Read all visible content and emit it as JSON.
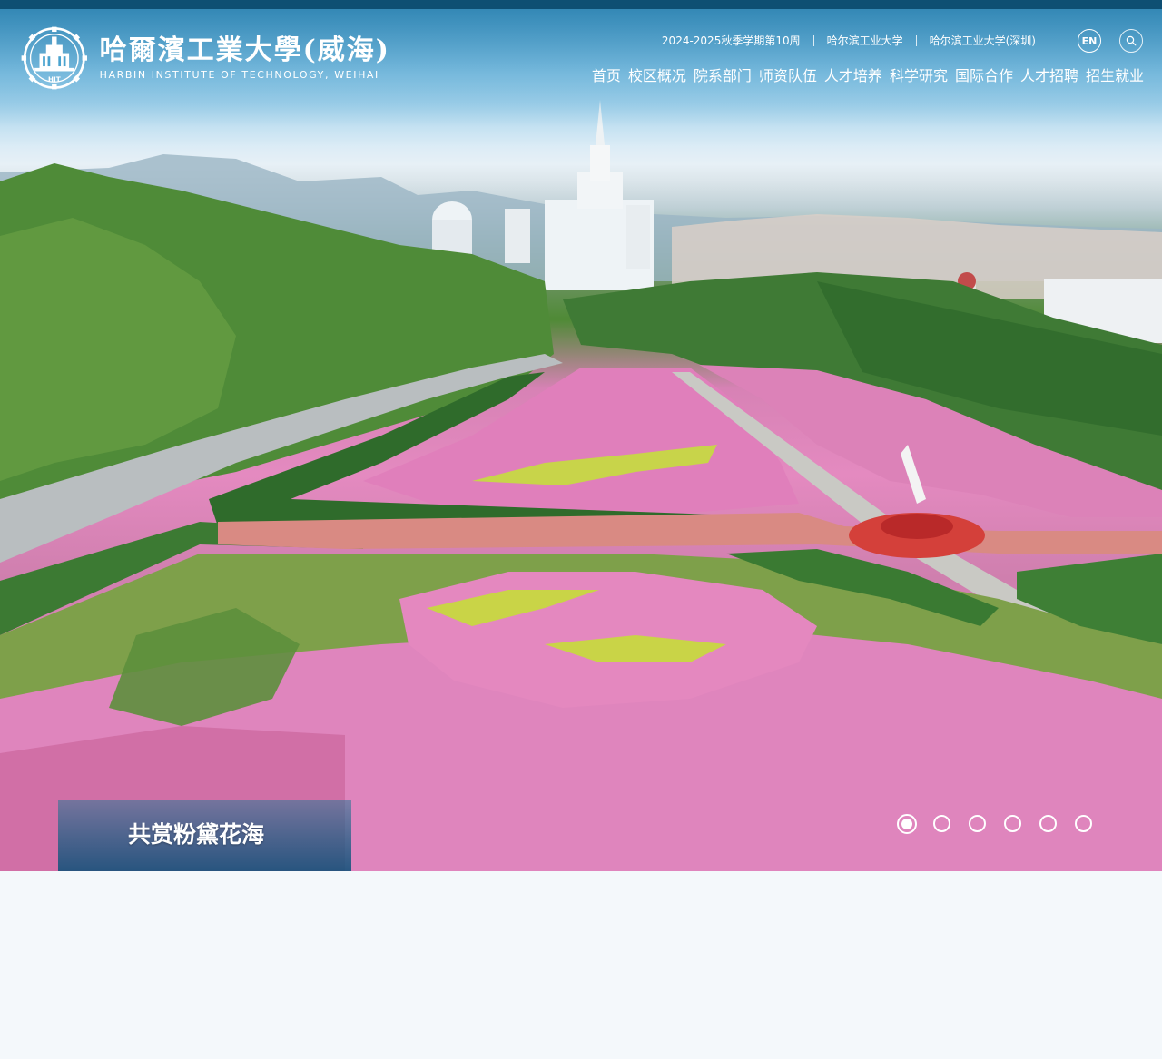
{
  "logo": {
    "name_cn": "哈爾濱工業大學(威海)",
    "name_en": "HARBIN INSTITUTE OF TECHNOLOGY, WEIHAI",
    "emblem_text": "HIT",
    "emblem_icon": "hit-emblem-icon"
  },
  "utility_links": [
    "2024-2025秋季学期第10周",
    "哈尔滨工业大学",
    "哈尔滨工业大学(深圳)"
  ],
  "language_button": "EN",
  "search": {
    "icon": "search-icon"
  },
  "nav": [
    "首页",
    "校区概况",
    "院系部门",
    "师资队伍",
    "人才培养",
    "科学研究",
    "国际合作",
    "人才招聘",
    "招生就业"
  ],
  "slider": {
    "caption": "共赏粉黛花海",
    "total_slides": 6,
    "active_index": 0
  },
  "colors": {
    "top_strip": "#0e4f73",
    "page_background": "#f4f8fb",
    "caption_panel": "#0a5078"
  }
}
